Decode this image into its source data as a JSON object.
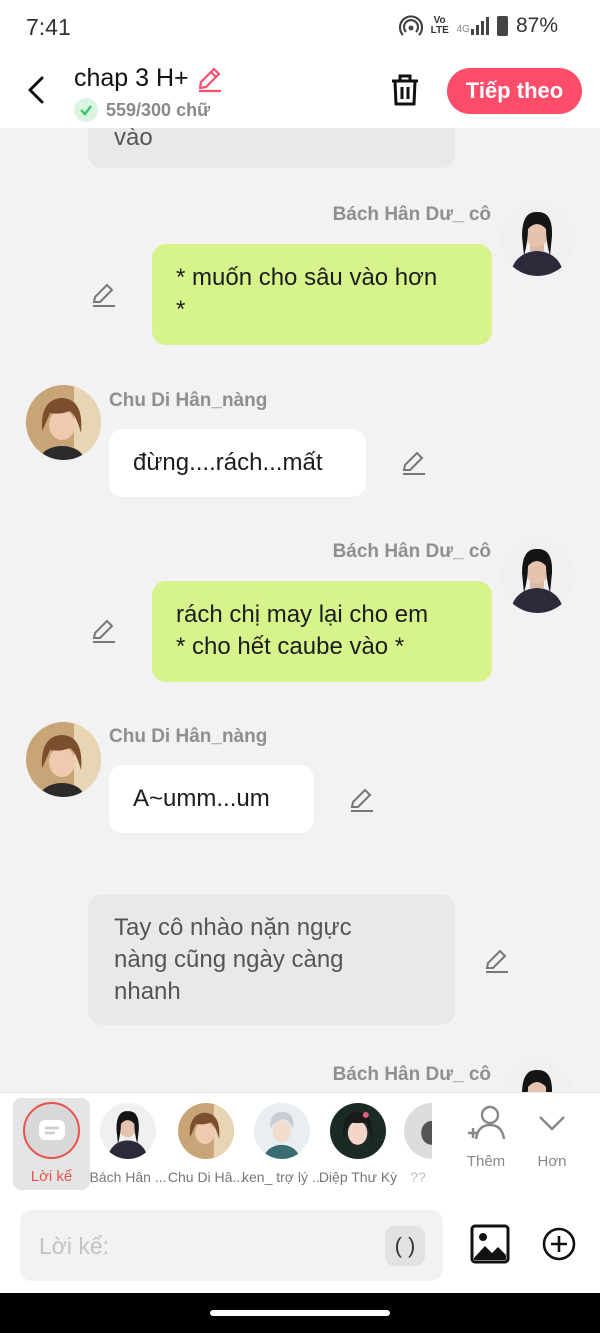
{
  "status": {
    "time": "7:41",
    "network": "4G",
    "volte_top": "Vo",
    "volte_bottom": "LTE",
    "battery": "87%"
  },
  "header": {
    "title": "chap 3 H+",
    "word_count": "559/300 chữ",
    "next_label": "Tiếp theo"
  },
  "messages": [
    {
      "type": "narration",
      "text": "vào"
    },
    {
      "type": "right",
      "speaker": "Bách Hân Dư_ cô",
      "line1": "* muốn cho sâu vào hơn",
      "line2": "*"
    },
    {
      "type": "left",
      "speaker": "Chu Di Hân_nàng",
      "text": "đừng....rách...mất"
    },
    {
      "type": "right",
      "speaker": "Bách Hân Dư_ cô",
      "line1": "rách chị may lại cho em",
      "line2": "* cho hết caube vào *"
    },
    {
      "type": "left",
      "speaker": "Chu Di Hân_nàng",
      "text": "A~umm...um"
    },
    {
      "type": "narration",
      "line1": "Tay cô nhào nặn ngực",
      "line2": "nàng cũng ngày càng",
      "line3": "nhanh"
    },
    {
      "type": "right",
      "speaker": "Bách Hân Dư_ cô"
    }
  ],
  "characters": [
    {
      "label": "Lời kể",
      "selected": true
    },
    {
      "label": "Bách Hân ..."
    },
    {
      "label": "Chu Di Hâ..."
    },
    {
      "label": "ken_ trợ lý ..."
    },
    {
      "label": "Diệp Thư Kỳ"
    },
    {
      "label": "??"
    }
  ],
  "tools": {
    "add_label": "Thêm",
    "more_label": "Hơn"
  },
  "composer": {
    "placeholder": "Lời kể:",
    "paren": "( )"
  },
  "colors": {
    "accent": "#fd4d6b",
    "green_bubble": "#d6f38c",
    "narration_bg": "#e9e9e9"
  }
}
